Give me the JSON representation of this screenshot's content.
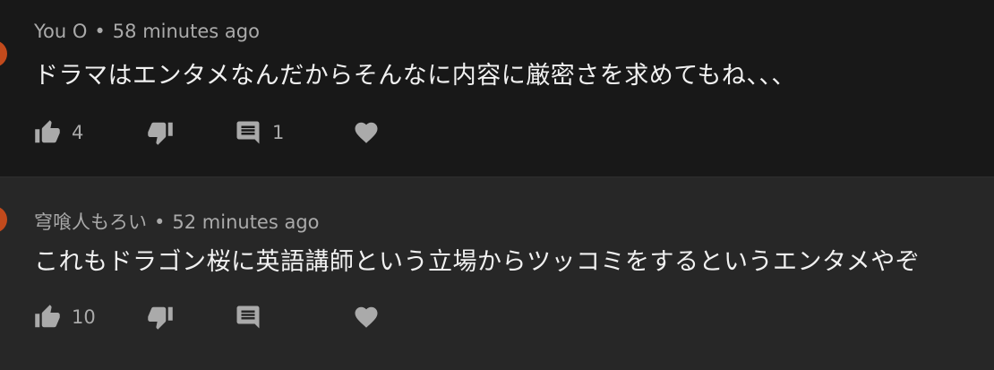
{
  "comments": [
    {
      "author": "You O",
      "time": "58 minutes ago",
      "text": "ドラマはエンタメなんだからそんなに内容に厳密さを求めてもね、、、",
      "likes": "4",
      "replies": "1",
      "avatar_color": "#c24a1c"
    },
    {
      "author": "穹喰人もろい",
      "time": "52 minutes ago",
      "text": "これもドラゴン桜に英語講師という立場からツッコミをするというエンタメやぞ",
      "likes": "10",
      "replies": "",
      "avatar_color": "#c24a1c"
    }
  ],
  "ui": {
    "separator": "•"
  },
  "colors": {
    "bg_dark": "#181818",
    "bg_light": "#272727",
    "icon": "#aaaaaa",
    "text": "#f1f1f1"
  }
}
